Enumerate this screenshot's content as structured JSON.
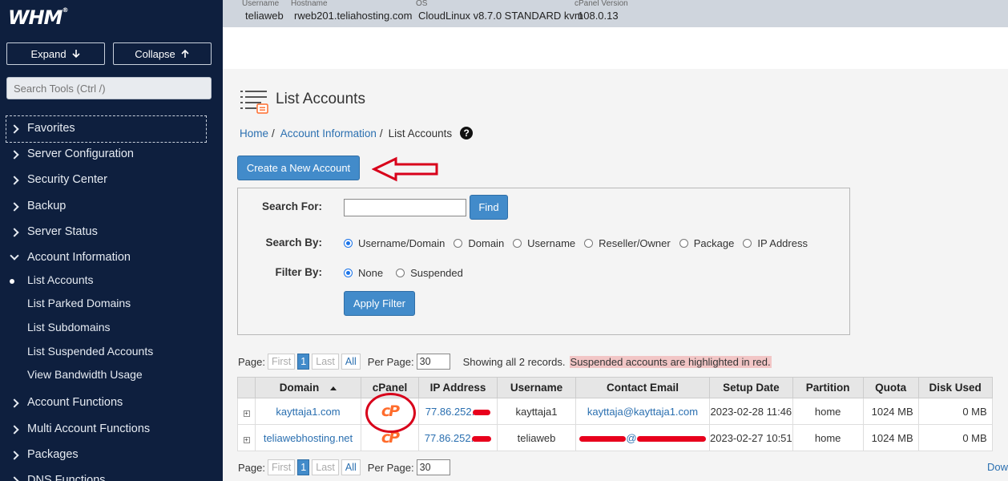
{
  "sidebar": {
    "logo": "WHM",
    "expand_label": "Expand",
    "collapse_label": "Collapse",
    "search_placeholder": "Search Tools (Ctrl /)",
    "items": [
      {
        "label": "Favorites",
        "state": "collapsed"
      },
      {
        "label": "Server Configuration",
        "state": "collapsed"
      },
      {
        "label": "Security Center",
        "state": "collapsed"
      },
      {
        "label": "Backup",
        "state": "collapsed"
      },
      {
        "label": "Server Status",
        "state": "collapsed"
      },
      {
        "label": "Account Information",
        "state": "expanded"
      },
      {
        "label": "Account Functions",
        "state": "collapsed"
      },
      {
        "label": "Multi Account Functions",
        "state": "collapsed"
      },
      {
        "label": "Packages",
        "state": "collapsed"
      },
      {
        "label": "DNS Functions",
        "state": "collapsed"
      }
    ],
    "subitems": [
      {
        "label": "List Accounts",
        "active": true
      },
      {
        "label": "List Parked Domains",
        "active": false
      },
      {
        "label": "List Subdomains",
        "active": false
      },
      {
        "label": "List Suspended Accounts",
        "active": false
      },
      {
        "label": "View Bandwidth Usage",
        "active": false
      }
    ]
  },
  "topbar": {
    "username_label": "Username",
    "username": "teliaweb",
    "hostname_label": "Hostname",
    "hostname": "rweb201.teliahosting.com",
    "os_label": "OS",
    "os": "CloudLinux v8.7.0 STANDARD kvm",
    "cpanel_label": "cPanel Version",
    "cpanel_version": "108.0.13"
  },
  "page": {
    "title": "List Accounts",
    "breadcrumb": [
      "Home",
      "Account Information",
      "List Accounts"
    ],
    "breadcrumb_sep": "/",
    "help": "?",
    "create_button": "Create a New Account"
  },
  "search": {
    "search_for_label": "Search For:",
    "search_value": "",
    "find_button": "Find",
    "search_by_label": "Search By:",
    "search_by_options": [
      "Username/Domain",
      "Domain",
      "Username",
      "Reseller/Owner",
      "Package",
      "IP Address"
    ],
    "search_by_selected": "Username/Domain",
    "filter_by_label": "Filter By:",
    "filter_by_options": [
      "None",
      "Suspended"
    ],
    "filter_by_selected": "None",
    "apply_button": "Apply Filter"
  },
  "pager": {
    "page_label": "Page:",
    "first": "First",
    "current": "1",
    "last": "Last",
    "all": "All",
    "per_page_label": "Per Page:",
    "per_page": "30",
    "showing": "Showing all 2 records.",
    "suspended_note": "Suspended accounts are highlighted in red."
  },
  "table": {
    "columns": [
      "",
      "Domain",
      "cPanel",
      "IP Address",
      "Username",
      "Contact Email",
      "Setup Date",
      "Partition",
      "Quota",
      "Disk Used"
    ],
    "rows": [
      {
        "expander": "+",
        "domain": "kayttaja1.com",
        "ip": "77.86.252.",
        "username": "kayttaja1",
        "email": "kayttaja@kayttaja1.com",
        "setup_date": "2023-02-28 11:46",
        "partition": "home",
        "quota": "1024 MB",
        "disk_used": "0 MB"
      },
      {
        "expander": "+",
        "domain": "teliawebhosting.net",
        "ip": "77.86.252.",
        "username": "teliaweb",
        "email": "@",
        "setup_date": "2023-02-27 10:51",
        "partition": "home",
        "quota": "1024 MB",
        "disk_used": "0 MB"
      }
    ],
    "cpanel_icon": "cP",
    "download_partial": "Dow"
  },
  "colors": {
    "sidebar_bg": "#0e1f3e",
    "primary_button": "#428bca",
    "link": "#2a6fb0",
    "annotation_red": "#d8001a",
    "suspended_highlight": "#f2c6c6",
    "cpanel_orange": "#ff6c2c"
  }
}
